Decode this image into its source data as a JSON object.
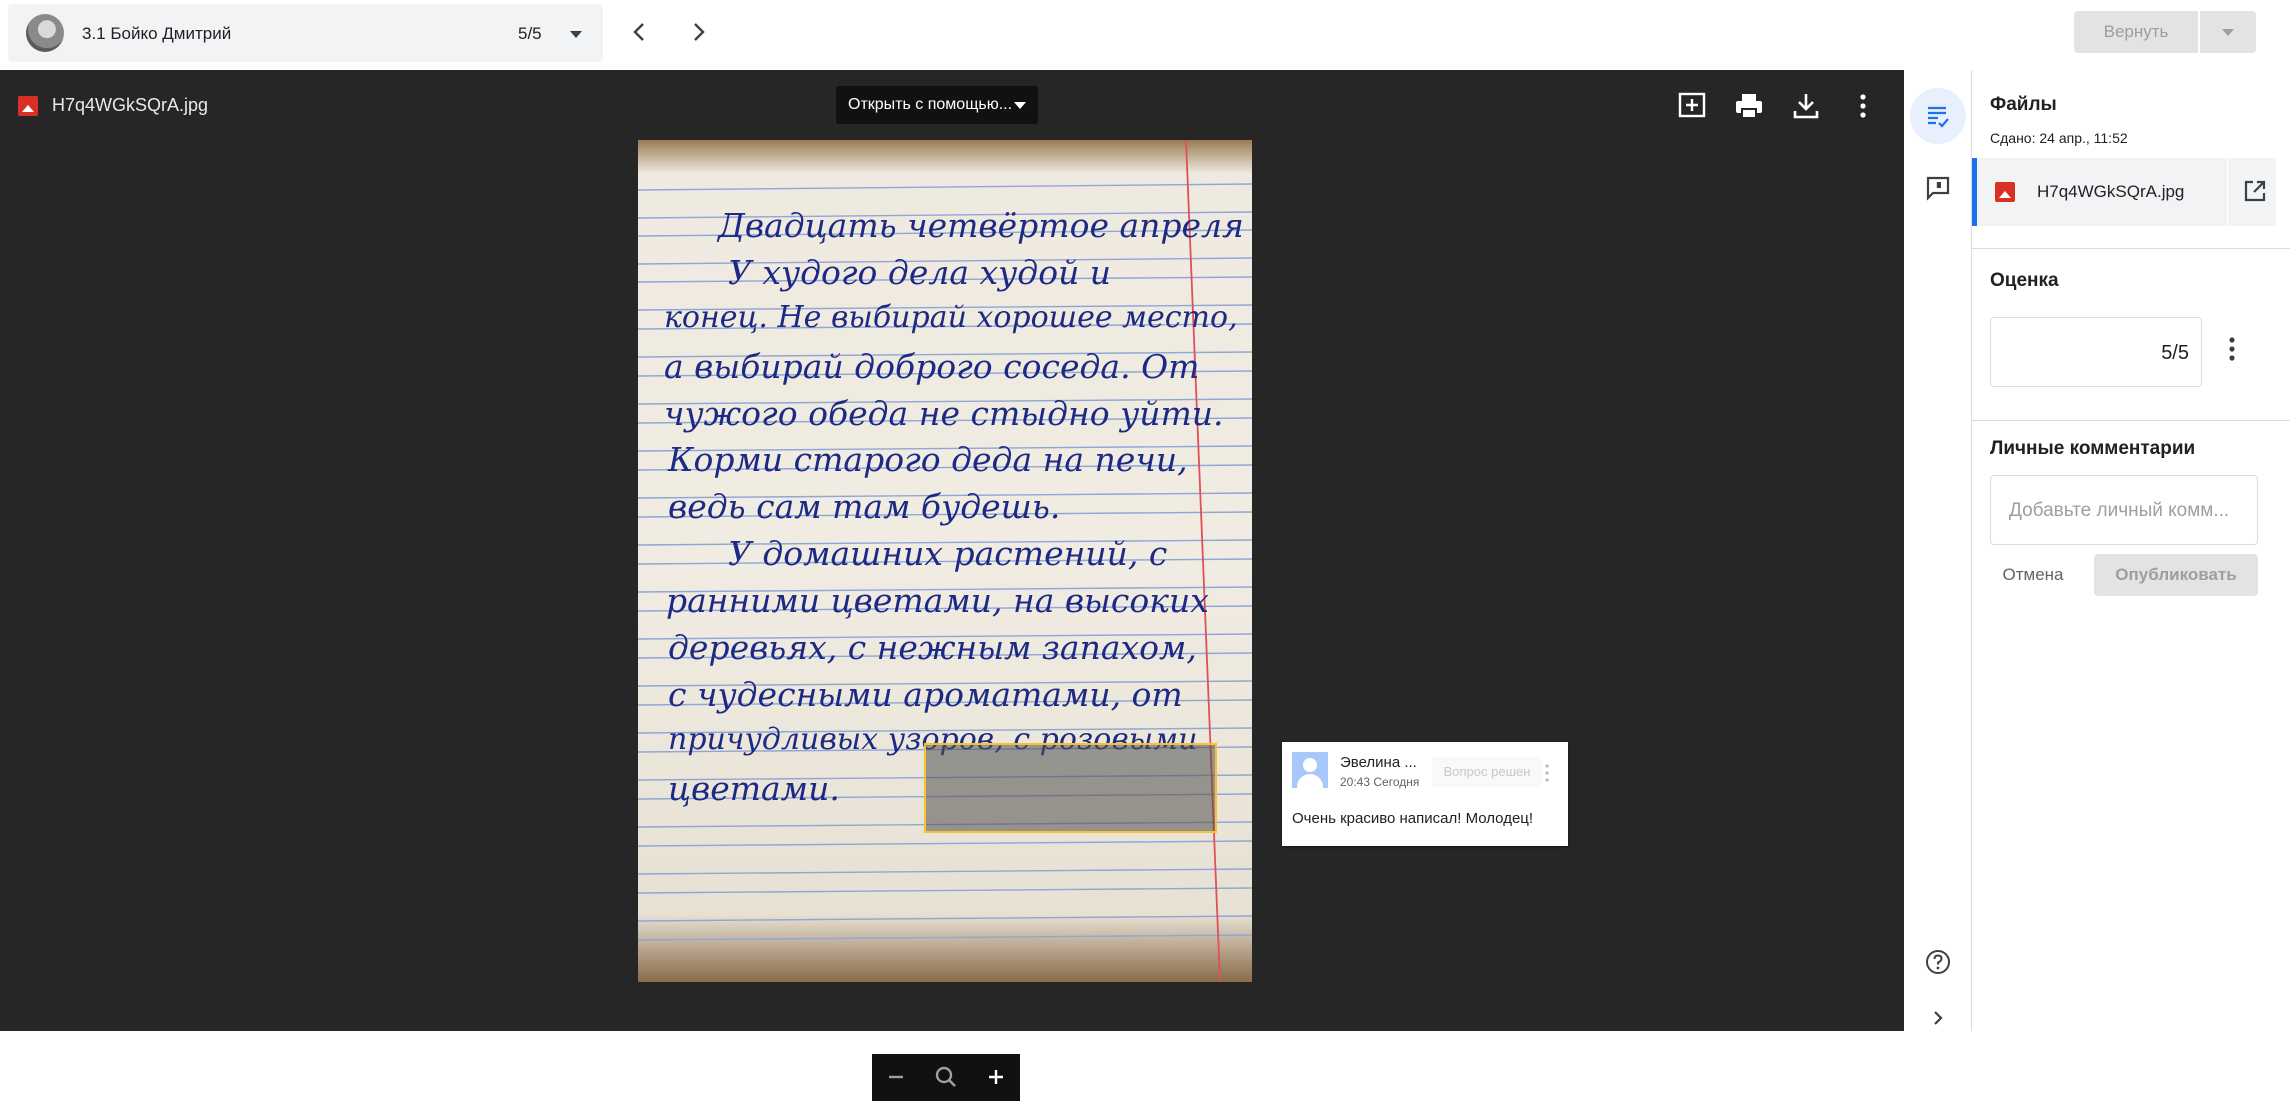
{
  "header": {
    "student_name": "3.1 Бойко Дмитрий",
    "student_count": "5/5",
    "return_label": "Вернуть"
  },
  "viewer": {
    "file_name": "H7q4WGkSQrA.jpg",
    "open_with_label": "Открыть с помощью...",
    "handwriting": [
      "Двадцать четвёртое апреля",
      "У худого дела худой и",
      "конец. Не выбирай хорошее место,",
      "а выбирай доброго соседа. От",
      "чужого обеда не стыдно уйти.",
      "Корми старого деда на печи,",
      "ведь сам там будешь.",
      "У домашних растений, с",
      "ранними цветами, на высоких",
      "деревьях, с нежным запахом,",
      "с чудесными ароматами, от",
      "причудливых узоров, с розовыми",
      "цветами."
    ]
  },
  "comment": {
    "author": "Эвелина ...",
    "time": "20:43 Сегодня",
    "resolve_label": "Вопрос решен",
    "text": "Очень красиво написал! Молодец!"
  },
  "panel": {
    "files_title": "Файлы",
    "submitted": "Сдано: 24 апр., 11:52",
    "file_name": "H7q4WGkSQrA.jpg",
    "grade_title": "Оценка",
    "grade_value": "5/5",
    "private_comments_title": "Личные комментарии",
    "comment_placeholder": "Добавьте личный комм...",
    "cancel_label": "Отмена",
    "publish_label": "Опубликовать"
  },
  "colors": {
    "accent": "#1a73e8",
    "viewer_bg": "#262626",
    "highlight": "#fbc02d",
    "file_icon": "#d93025"
  }
}
